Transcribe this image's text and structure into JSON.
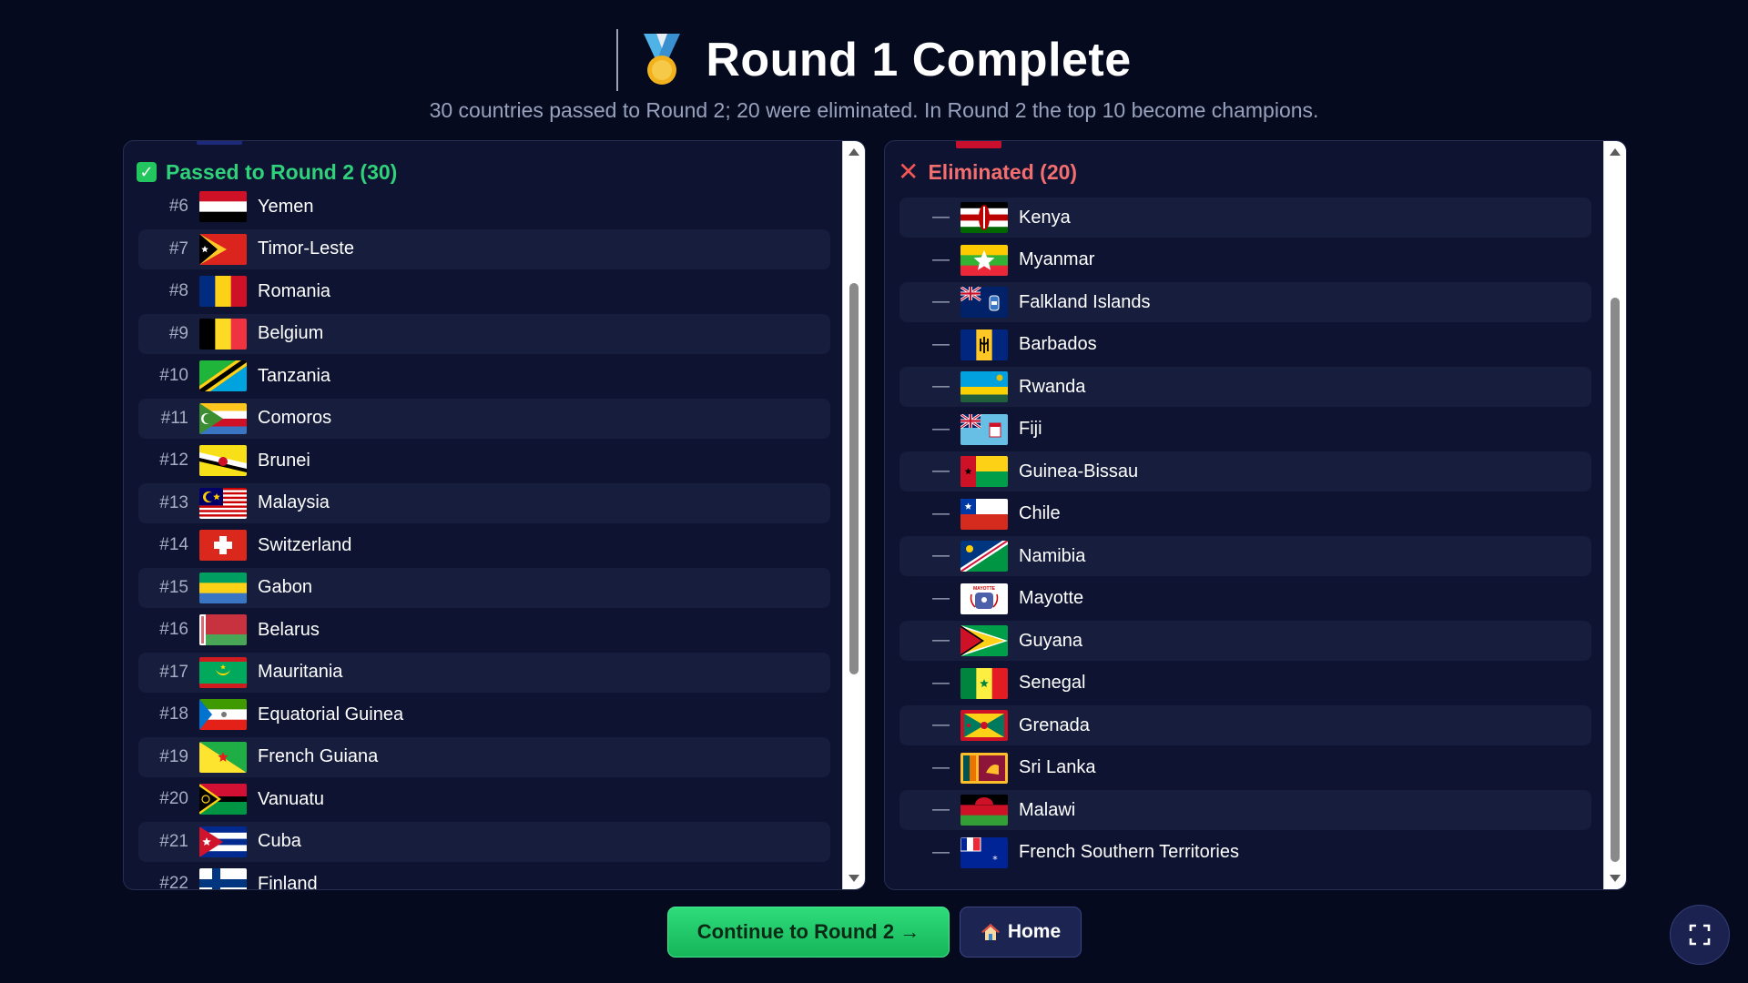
{
  "header": {
    "title": "Round 1 Complete",
    "subtitle": "30 countries passed to Round 2; 20 were eliminated. In Round 2 the top 10 become champions.",
    "medal_icon": "medal-icon"
  },
  "passed": {
    "title": "Passed to Round 2 (30)",
    "rows": [
      {
        "rank": "#6",
        "name": "Yemen",
        "flag": "yemen"
      },
      {
        "rank": "#7",
        "name": "Timor-Leste",
        "flag": "timor-leste"
      },
      {
        "rank": "#8",
        "name": "Romania",
        "flag": "romania"
      },
      {
        "rank": "#9",
        "name": "Belgium",
        "flag": "belgium"
      },
      {
        "rank": "#10",
        "name": "Tanzania",
        "flag": "tanzania"
      },
      {
        "rank": "#11",
        "name": "Comoros",
        "flag": "comoros"
      },
      {
        "rank": "#12",
        "name": "Brunei",
        "flag": "brunei"
      },
      {
        "rank": "#13",
        "name": "Malaysia",
        "flag": "malaysia"
      },
      {
        "rank": "#14",
        "name": "Switzerland",
        "flag": "switzerland"
      },
      {
        "rank": "#15",
        "name": "Gabon",
        "flag": "gabon"
      },
      {
        "rank": "#16",
        "name": "Belarus",
        "flag": "belarus"
      },
      {
        "rank": "#17",
        "name": "Mauritania",
        "flag": "mauritania"
      },
      {
        "rank": "#18",
        "name": "Equatorial Guinea",
        "flag": "equatorial-guinea"
      },
      {
        "rank": "#19",
        "name": "French Guiana",
        "flag": "french-guiana"
      },
      {
        "rank": "#20",
        "name": "Vanuatu",
        "flag": "vanuatu"
      },
      {
        "rank": "#21",
        "name": "Cuba",
        "flag": "cuba"
      },
      {
        "rank": "#22",
        "name": "Finland",
        "flag": "finland"
      }
    ]
  },
  "eliminated": {
    "title": "Eliminated (20)",
    "dash": "—",
    "rows": [
      {
        "name": "Kenya",
        "flag": "kenya"
      },
      {
        "name": "Myanmar",
        "flag": "myanmar"
      },
      {
        "name": "Falkland Islands",
        "flag": "falkland-islands"
      },
      {
        "name": "Barbados",
        "flag": "barbados"
      },
      {
        "name": "Rwanda",
        "flag": "rwanda"
      },
      {
        "name": "Fiji",
        "flag": "fiji"
      },
      {
        "name": "Guinea-Bissau",
        "flag": "guinea-bissau"
      },
      {
        "name": "Chile",
        "flag": "chile"
      },
      {
        "name": "Namibia",
        "flag": "namibia"
      },
      {
        "name": "Mayotte",
        "flag": "mayotte"
      },
      {
        "name": "Guyana",
        "flag": "guyana"
      },
      {
        "name": "Senegal",
        "flag": "senegal"
      },
      {
        "name": "Grenada",
        "flag": "grenada"
      },
      {
        "name": "Sri Lanka",
        "flag": "sri-lanka"
      },
      {
        "name": "Malawi",
        "flag": "malawi"
      },
      {
        "name": "French Southern Territories",
        "flag": "french-southern-territories"
      }
    ]
  },
  "buttons": {
    "continue_label": "Continue to Round 2 →",
    "home_label": "Home",
    "home_icon": "house-icon",
    "fullscreen_icon": "fullscreen-icon"
  }
}
